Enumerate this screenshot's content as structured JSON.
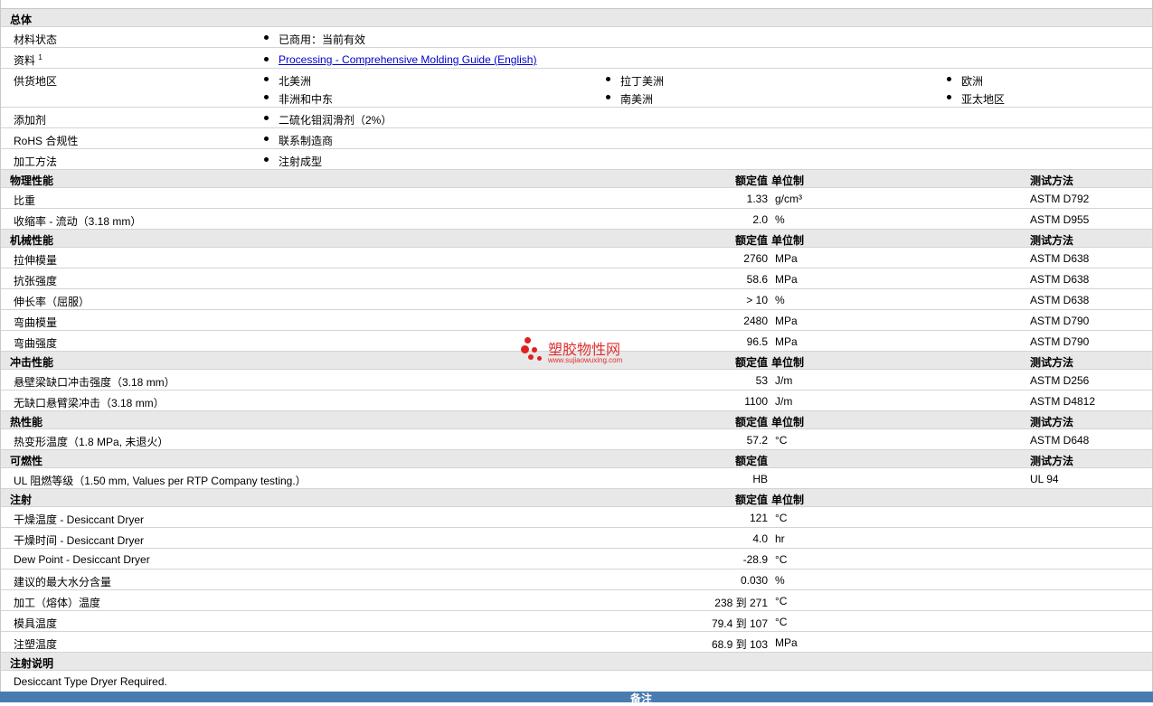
{
  "general": {
    "title": "总体",
    "status_label": "材料状态",
    "status_value": "已商用：当前有效",
    "docs_label": "资料",
    "docs_sup": "1",
    "docs_link": "Processing - Comprehensive Molding Guide (English)",
    "regions_label": "供货地区",
    "regions": [
      "北美洲",
      "拉丁美洲",
      "欧洲",
      "非洲和中东",
      "南美洲",
      "亚太地区"
    ],
    "additive_label": "添加剂",
    "additive_value": "二硫化钼润滑剂（2%）",
    "rohs_label": "RoHS 合规性",
    "rohs_value": "联系制造商",
    "process_label": "加工方法",
    "process_value": "注射成型"
  },
  "headers": {
    "nominal": "额定值",
    "unit": "单位制",
    "test": "测试方法"
  },
  "physical": {
    "title": "物理性能",
    "rows": [
      {
        "label": "比重",
        "value": "1.33",
        "unit": "g/cm³",
        "test": "ASTM D792"
      },
      {
        "label": "收缩率 - 流动（3.18 mm）",
        "value": "2.0",
        "unit": "%",
        "test": "ASTM D955"
      }
    ]
  },
  "mechanical": {
    "title": "机械性能",
    "rows": [
      {
        "label": "拉伸模量",
        "value": "2760",
        "unit": "MPa",
        "test": "ASTM D638"
      },
      {
        "label": "抗张强度",
        "value": "58.6",
        "unit": "MPa",
        "test": "ASTM D638"
      },
      {
        "label": "伸长率（屈服）",
        "value": "> 10",
        "unit": "%",
        "test": "ASTM D638"
      },
      {
        "label": "弯曲模量",
        "value": "2480",
        "unit": "MPa",
        "test": "ASTM D790"
      },
      {
        "label": "弯曲强度",
        "value": "96.5",
        "unit": "MPa",
        "test": "ASTM D790"
      }
    ]
  },
  "impact": {
    "title": "冲击性能",
    "rows": [
      {
        "label": "悬壁梁缺口冲击强度（3.18 mm）",
        "value": "53",
        "unit": "J/m",
        "test": "ASTM D256"
      },
      {
        "label": "无缺口悬臂梁冲击（3.18 mm）",
        "value": "1100",
        "unit": "J/m",
        "test": "ASTM D4812"
      }
    ]
  },
  "thermal": {
    "title": "热性能",
    "rows": [
      {
        "label": "热变形温度（1.8 MPa, 未退火）",
        "value": "57.2",
        "unit": "°C",
        "test": "ASTM D648"
      }
    ]
  },
  "flammability": {
    "title": "可燃性",
    "rows": [
      {
        "label": "UL 阻燃等级（1.50 mm, Values per RTP Company testing.）",
        "value": "HB",
        "unit": "",
        "test": "UL 94"
      }
    ]
  },
  "injection": {
    "title": "注射",
    "rows": [
      {
        "label": "干燥温度 - Desiccant Dryer",
        "value": "121",
        "unit": "°C"
      },
      {
        "label": "干燥时间 - Desiccant Dryer",
        "value": "4.0",
        "unit": "hr"
      },
      {
        "label": "Dew Point - Desiccant Dryer",
        "value": "-28.9",
        "unit": "°C"
      },
      {
        "label": "建议的最大水分含量",
        "value": "0.030",
        "unit": "%"
      },
      {
        "label": "加工（熔体）温度",
        "value": "238 到 271",
        "unit": "°C"
      },
      {
        "label": "模具温度",
        "value": "79.4 到 107",
        "unit": "°C"
      },
      {
        "label": "注塑温度",
        "value": "68.9 到 103",
        "unit": "MPa"
      }
    ]
  },
  "injection_notes": {
    "title": "注射说明",
    "text": "Desiccant Type Dryer Required."
  },
  "footer": {
    "label": "备注"
  },
  "watermark": {
    "text": "塑胶物性网",
    "url": "www.sujiaowuxing.com",
    "color": "#e03030"
  }
}
